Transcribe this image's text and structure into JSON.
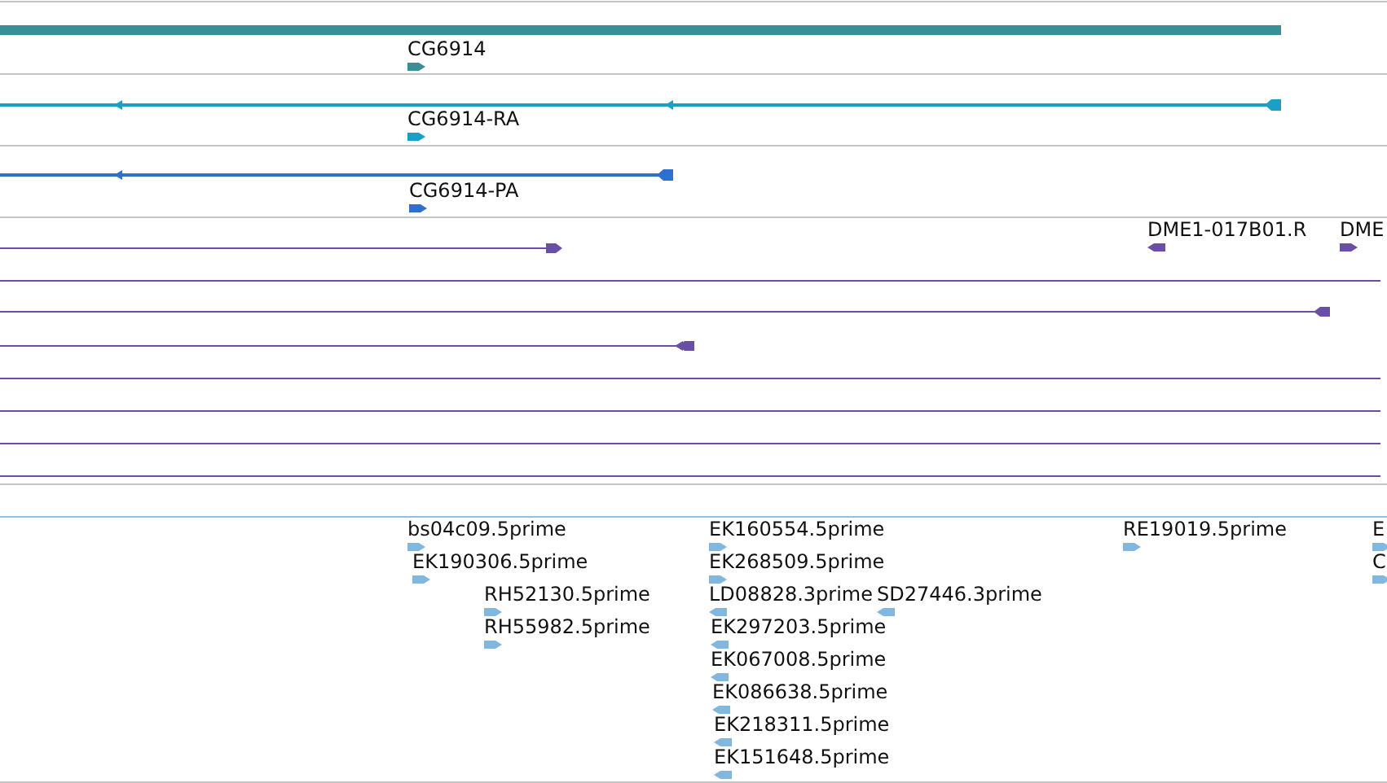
{
  "tracks": [
    {
      "kind": "gene",
      "lines": [
        {
          "kind": "plain"
        }
      ],
      "features": [
        {
          "label": "CG6914",
          "reverse": false
        }
      ]
    },
    {
      "kind": "transcript",
      "lines": [
        {
          "kind": "reverse"
        }
      ],
      "features": [
        {
          "label": "CG6914-RA",
          "reverse": false
        }
      ]
    },
    {
      "kind": "protein",
      "lines": [
        {
          "kind": "reverse"
        }
      ],
      "features": [
        {
          "label": "CG6914-PA",
          "reverse": false
        }
      ]
    },
    {
      "kind": "alignment",
      "lines": [
        {
          "kind": "forward"
        },
        {
          "kind": "plain"
        },
        {
          "kind": "reverse"
        },
        {
          "kind": "reverse"
        },
        {
          "kind": "plain"
        },
        {
          "kind": "plain"
        },
        {
          "kind": "plain"
        },
        {
          "kind": "plain"
        }
      ],
      "features": [
        {
          "label": "DME1-017B01.R",
          "reverse": true
        },
        {
          "label": "DME",
          "reverse": false
        }
      ]
    },
    {
      "kind": "est",
      "features": [
        {
          "label": "bs04c09.5prime",
          "reverse": false
        },
        {
          "label": "EK190306.5prime",
          "reverse": false
        },
        {
          "label": "RH52130.5prime",
          "reverse": false
        },
        {
          "label": "RH55982.5prime",
          "reverse": false
        },
        {
          "label": "EK160554.5prime",
          "reverse": false
        },
        {
          "label": "EK268509.5prime",
          "reverse": false
        },
        {
          "label": "LD08828.3prime",
          "reverse": true
        },
        {
          "label": "SD27446.3prime",
          "reverse": true
        },
        {
          "label": "EK297203.5prime",
          "reverse": true
        },
        {
          "label": "EK067008.5prime",
          "reverse": true
        },
        {
          "label": "EK086638.5prime",
          "reverse": true
        },
        {
          "label": "EK218311.5prime",
          "reverse": true
        },
        {
          "label": "EK151648.5prime",
          "reverse": true
        },
        {
          "label": "RE19019.5prime",
          "reverse": false
        },
        {
          "label": "E",
          "reverse": false
        },
        {
          "label": "C",
          "reverse": false
        }
      ]
    }
  ]
}
